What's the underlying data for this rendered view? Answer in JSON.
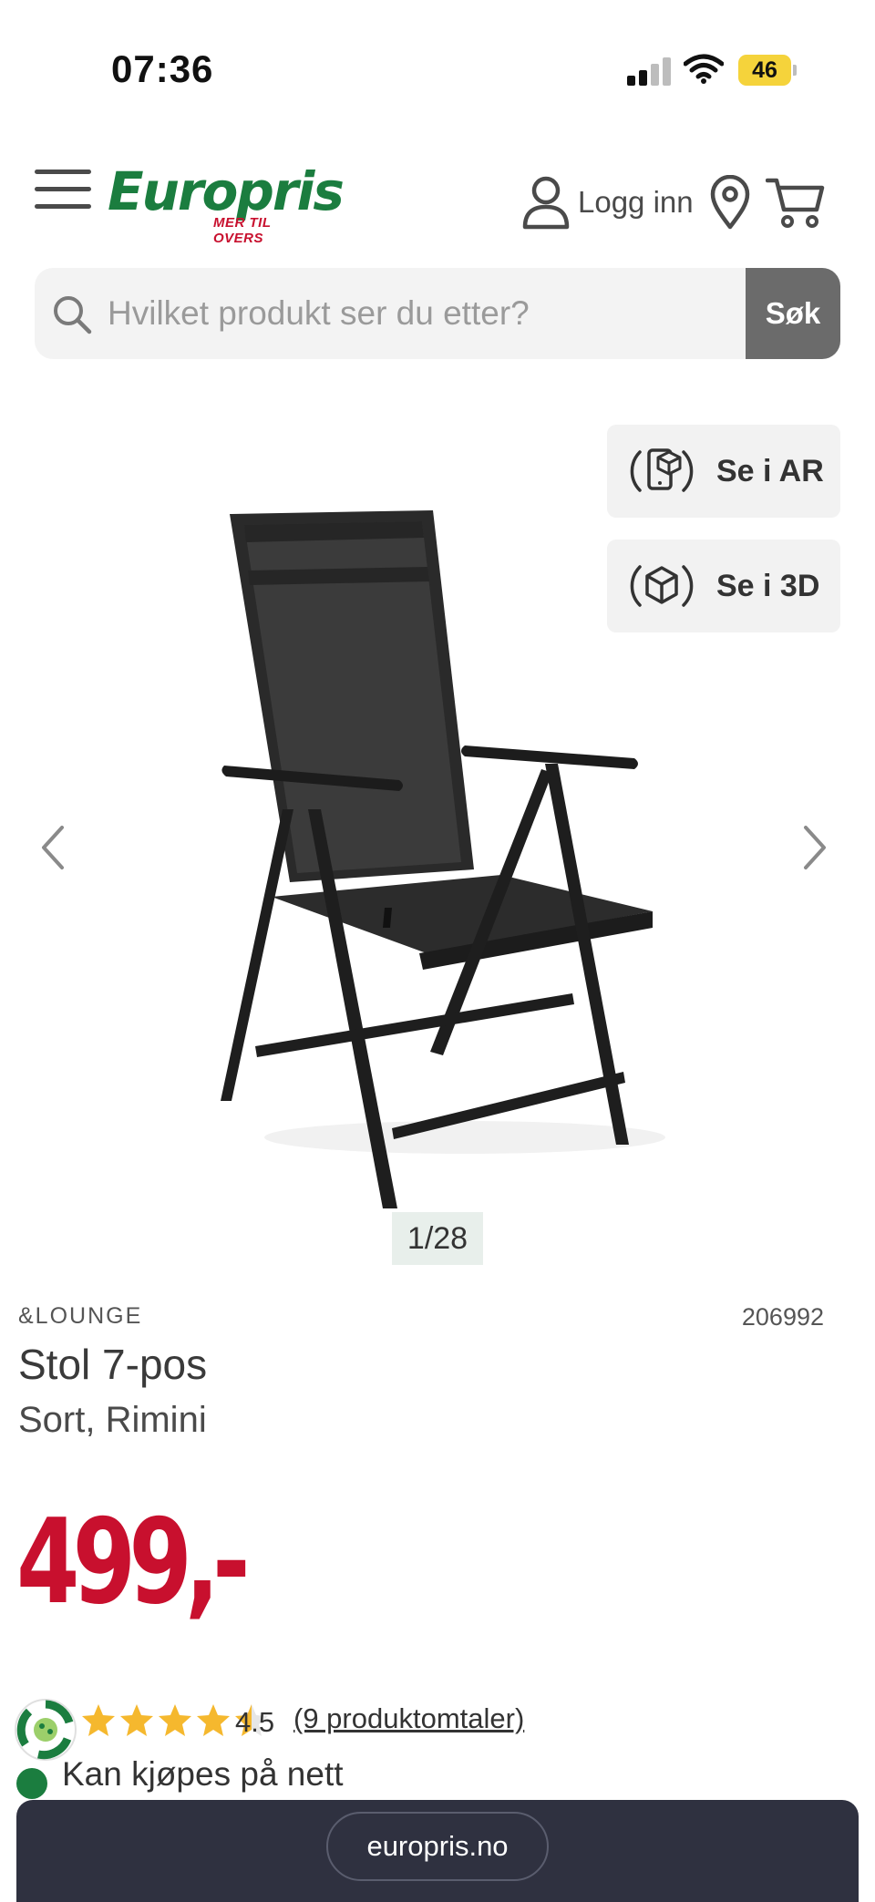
{
  "status_bar": {
    "time": "07:36",
    "battery": "46"
  },
  "header": {
    "logo_text": "Europris",
    "logo_tagline": "MER TIL OVERS",
    "login_label": "Logg inn",
    "icons": [
      "menu-icon",
      "user-icon",
      "location-pin-icon",
      "cart-icon"
    ]
  },
  "search": {
    "placeholder": "Hvilket produkt ser du etter?",
    "button_label": "Søk"
  },
  "gallery": {
    "ar_label": "Se i AR",
    "threed_label": "Se i 3D",
    "counter": "1/28",
    "current_image": 1,
    "total_images": 28
  },
  "product": {
    "brand": "&LOUNGE",
    "sku": "206992",
    "title": "Stol 7-pos",
    "variant": "Sort, Rimini",
    "price": "499,-"
  },
  "rating": {
    "value": "4.5",
    "stars": 4.5,
    "max_stars": 5,
    "review_link": "(9 produktomtaler)",
    "star_color": "#f5b82e"
  },
  "availability": {
    "text": "Kan kjøpes på nett",
    "status_color": "#1b7d3f"
  },
  "browser": {
    "url": "europris.no"
  },
  "colors": {
    "brand_green": "#1b7d3f",
    "price_red": "#c8102e",
    "bottom_bar": "#2f3140"
  }
}
